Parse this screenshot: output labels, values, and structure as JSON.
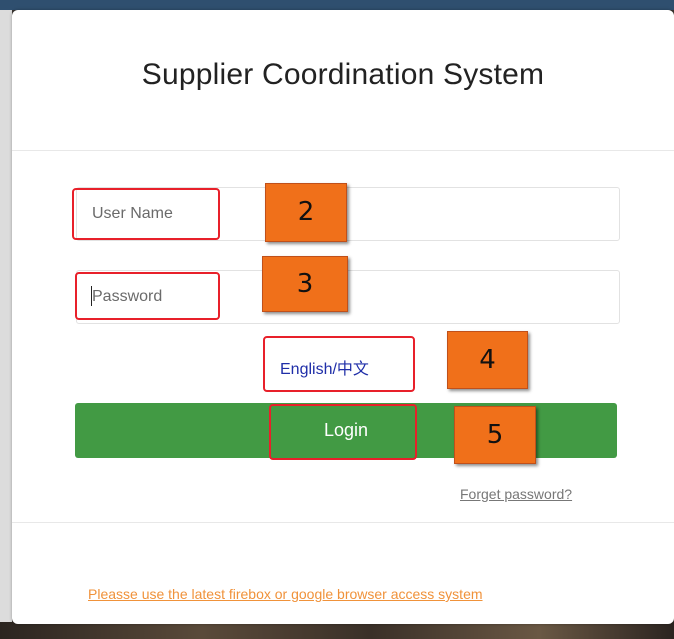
{
  "login": {
    "title": "Supplier Coordination System",
    "username_placeholder": "User Name",
    "password_placeholder": "Password",
    "language_link": "English/中文",
    "login_label": "Login",
    "forget_password": "Forget password?",
    "browser_notice": "Pleasse use the latest firebox or google browser access system"
  },
  "annotations": [
    "2",
    "3",
    "4",
    "5"
  ],
  "colors": {
    "login_button": "#429a44",
    "highlight": "#e8202a",
    "callout": "#f0701a",
    "notice_text": "#f0923a",
    "link_text": "#1f2ea8"
  }
}
